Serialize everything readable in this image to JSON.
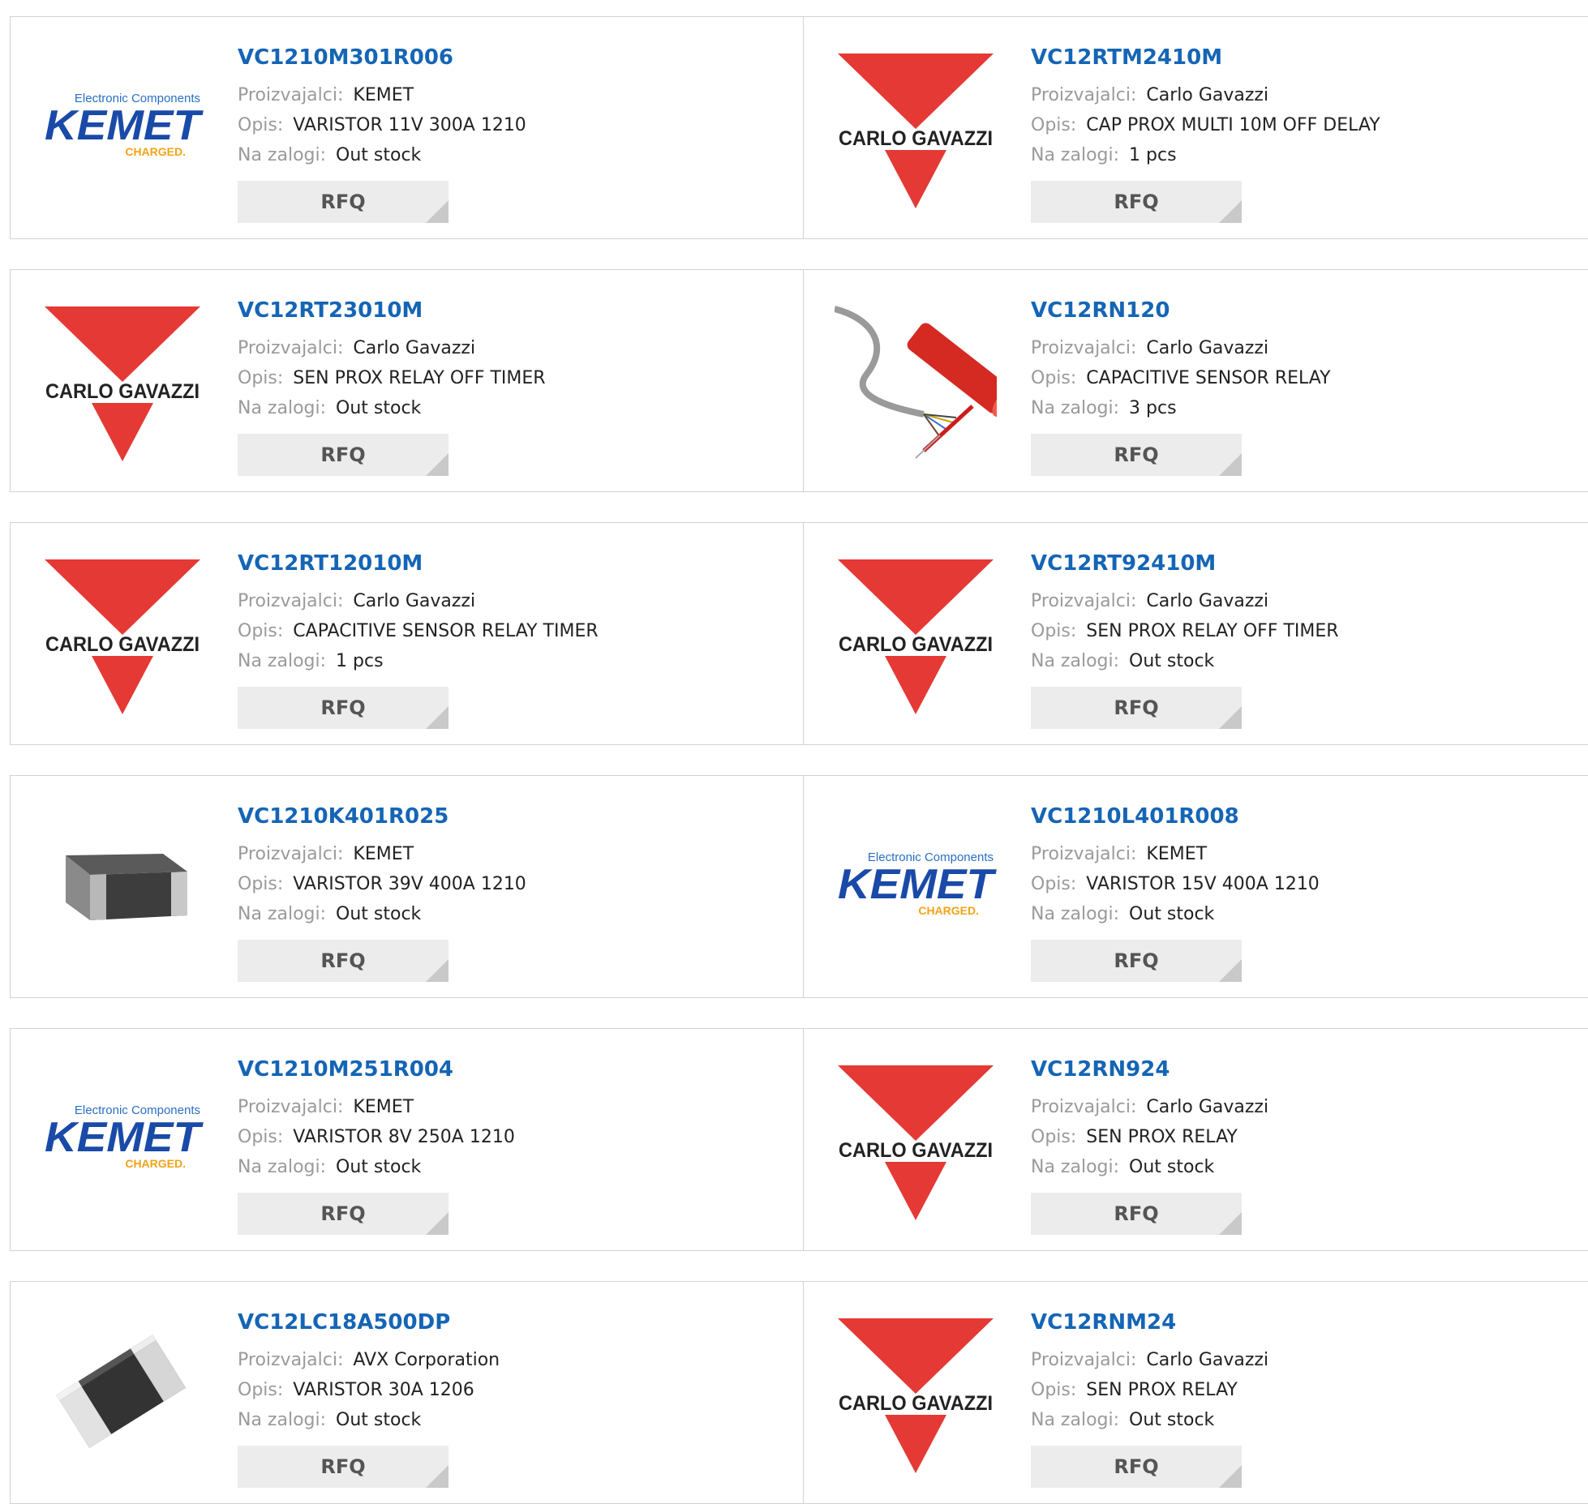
{
  "labels": {
    "manufacturer": "Proizvajalci:",
    "description": "Opis:",
    "stock": "Na zalogi:",
    "rfq": "RFQ"
  },
  "logos": {
    "kemet": {
      "tagline": "Electronic Components",
      "name": "KEMET",
      "sub": "CHARGED."
    },
    "gavazzi": {
      "name": "CARLO GAVAZZI"
    }
  },
  "colors": {
    "link": "#1565b5",
    "gavazzi_red": "#e53935",
    "kemet_blue": "#1a4aa8",
    "kemet_orange": "#f2a316"
  },
  "products": [
    {
      "pn": "VC1210M301R006",
      "manufacturer": "KEMET",
      "description": "VARISTOR 11V 300A 1210",
      "stock": "Out stock",
      "image": "kemet-logo"
    },
    {
      "pn": "VC12RTM2410M",
      "manufacturer": "Carlo Gavazzi",
      "description": "CAP PROX MULTI 10M OFF DELAY",
      "stock": "1 pcs",
      "image": "carlo-gavazzi-logo"
    },
    {
      "pn": "VC12RT23010M",
      "manufacturer": "Carlo Gavazzi",
      "description": "SEN PROX RELAY OFF TIMER",
      "stock": "Out stock",
      "image": "carlo-gavazzi-logo"
    },
    {
      "pn": "VC12RN120",
      "manufacturer": "Carlo Gavazzi",
      "description": "CAPACITIVE SENSOR RELAY",
      "stock": "3 pcs",
      "image": "sensor-cable-photo"
    },
    {
      "pn": "VC12RT12010M",
      "manufacturer": "Carlo Gavazzi",
      "description": "CAPACITIVE SENSOR RELAY TIMER",
      "stock": "1 pcs",
      "image": "carlo-gavazzi-logo"
    },
    {
      "pn": "VC12RT92410M",
      "manufacturer": "Carlo Gavazzi",
      "description": "SEN PROX RELAY OFF TIMER",
      "stock": "Out stock",
      "image": "carlo-gavazzi-logo"
    },
    {
      "pn": "VC1210K401R025",
      "manufacturer": "KEMET",
      "description": "VARISTOR 39V 400A 1210",
      "stock": "Out stock",
      "image": "smd-chip-photo"
    },
    {
      "pn": "VC1210L401R008",
      "manufacturer": "KEMET",
      "description": "VARISTOR 15V 400A 1210",
      "stock": "Out stock",
      "image": "kemet-logo"
    },
    {
      "pn": "VC1210M251R004",
      "manufacturer": "KEMET",
      "description": "VARISTOR 8V 250A 1210",
      "stock": "Out stock",
      "image": "kemet-logo"
    },
    {
      "pn": "VC12RN924",
      "manufacturer": "Carlo Gavazzi",
      "description": "SEN PROX RELAY",
      "stock": "Out stock",
      "image": "carlo-gavazzi-logo"
    },
    {
      "pn": "VC12LC18A500DP",
      "manufacturer": "AVX Corporation",
      "description": "VARISTOR 30A 1206",
      "stock": "Out stock",
      "image": "smd-chip-small-photo"
    },
    {
      "pn": "VC12RNM24",
      "manufacturer": "Carlo Gavazzi",
      "description": "SEN PROX RELAY",
      "stock": "Out stock",
      "image": "carlo-gavazzi-logo"
    }
  ]
}
